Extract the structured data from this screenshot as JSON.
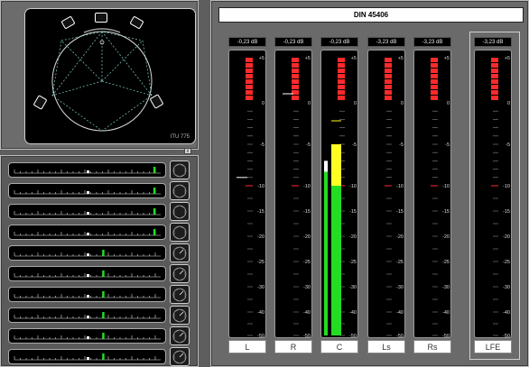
{
  "surround": {
    "scope_label": "ITU 775",
    "speaker_icons": [
      "speaker-icon",
      "speaker-icon",
      "speaker-icon",
      "speaker-icon",
      "speaker-icon"
    ],
    "close_glyph": "x"
  },
  "strips": {
    "count": 10,
    "scale_marks": [
      "-4",
      "0",
      "+4"
    ],
    "green_level": [
      0.95,
      0.95,
      0.95,
      0.95,
      0.6,
      0.6,
      0.6,
      0.6,
      0.6,
      0.6
    ]
  },
  "meters": {
    "title": "DIN 45406",
    "scale": [
      "+5",
      "0",
      "-5",
      "-10",
      "-15",
      "-20",
      "-25",
      "-30",
      "-40",
      "-50"
    ],
    "channels": [
      {
        "id": "L",
        "label": "L",
        "value": "-0,23 dB",
        "peak_db": -9,
        "bar_db": null,
        "yellow_db": null
      },
      {
        "id": "R",
        "label": "R",
        "value": "-0,23 dB",
        "peak_db": 1,
        "bar_db": null,
        "yellow_db": null
      },
      {
        "id": "C",
        "label": "C",
        "value": "-0,23 dB",
        "peak_db": -2,
        "bar_db": -10,
        "yellow_db": -5
      },
      {
        "id": "Ls",
        "label": "Ls",
        "value": "-3,23 dB",
        "peak_db": null,
        "bar_db": null,
        "yellow_db": null
      },
      {
        "id": "Rs",
        "label": "Rs",
        "value": "-3,23 dB",
        "peak_db": null,
        "bar_db": null,
        "yellow_db": null
      },
      {
        "id": "LFE",
        "label": "LFE",
        "value": "-3,23 dB",
        "peak_db": null,
        "bar_db": null,
        "yellow_db": null
      }
    ],
    "colors": {
      "over": "#ff2a2a",
      "bar": "#22dd22",
      "yellow": "#ffff22",
      "white": "#ffffff",
      "peak_line": "#ffffff"
    }
  }
}
